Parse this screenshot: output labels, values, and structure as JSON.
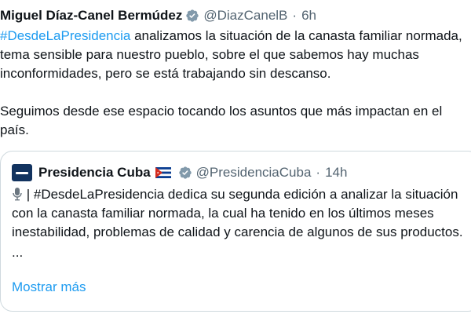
{
  "tweet": {
    "author_name": "Miguel Díaz-Canel Bermúdez",
    "handle": "@DiazCanelB",
    "separator": "·",
    "time": "6h",
    "hashtag": "#DesdeLaPresidencia",
    "text_line1_rest": " analizamos la situación de la canasta familiar normada, tema sensible para nuestro pueblo, sobre el que sabemos hay muchas inconformidades, pero se está trabajando sin descanso.",
    "paragraph2": "Seguimos desde ese espacio tocando los asuntos que más impactan en el país."
  },
  "quote": {
    "name": "Presidencia Cuba",
    "handle": "@PresidenciaCuba",
    "separator": "·",
    "time": "14h",
    "text": "| #DesdeLaPresidencia dedica su segunda edición a analizar la situación con la canasta familiar normada, la cual ha tenido en los últimos meses inestabilidad, problemas de calidad y carencia de algunos de sus productos.",
    "ellipsis": "...",
    "show_more": "Mostrar más"
  },
  "colors": {
    "link": "#1d9bf0",
    "text": "#0f1419",
    "muted": "#536471",
    "border": "#cfd9de",
    "verified": "#829aab"
  },
  "icons": {
    "verified": "verified-badge-icon",
    "flag": "cuba-flag-icon",
    "mic": "microphone-icon",
    "avatar": "presidencia-logo"
  }
}
